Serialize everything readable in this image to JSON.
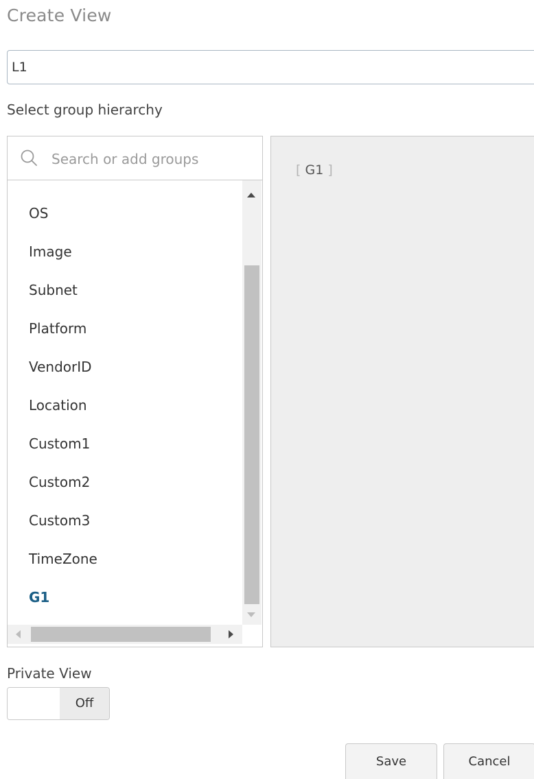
{
  "dialog": {
    "title": "Create View"
  },
  "view_name": {
    "value": "L1"
  },
  "hierarchy": {
    "label": "Select group hierarchy",
    "search": {
      "placeholder": "Search or add groups",
      "icon": "search-icon"
    },
    "groups": [
      {
        "label": "OS",
        "selected": false
      },
      {
        "label": "Image",
        "selected": false
      },
      {
        "label": "Subnet",
        "selected": false
      },
      {
        "label": "Platform",
        "selected": false
      },
      {
        "label": "VendorID",
        "selected": false
      },
      {
        "label": "Location",
        "selected": false
      },
      {
        "label": "Custom1",
        "selected": false
      },
      {
        "label": "Custom2",
        "selected": false
      },
      {
        "label": "Custom3",
        "selected": false
      },
      {
        "label": "TimeZone",
        "selected": false
      },
      {
        "label": "G1",
        "selected": true
      }
    ],
    "selected_tokens": {
      "open": "[",
      "value": "G1",
      "close": "]"
    }
  },
  "private_view": {
    "label": "Private View",
    "state": "Off"
  },
  "actions": {
    "save_label": "Save",
    "cancel_label": "Cancel"
  },
  "colors": {
    "selected_group": "#1b5f86",
    "panel_background": "#eeeeee"
  }
}
